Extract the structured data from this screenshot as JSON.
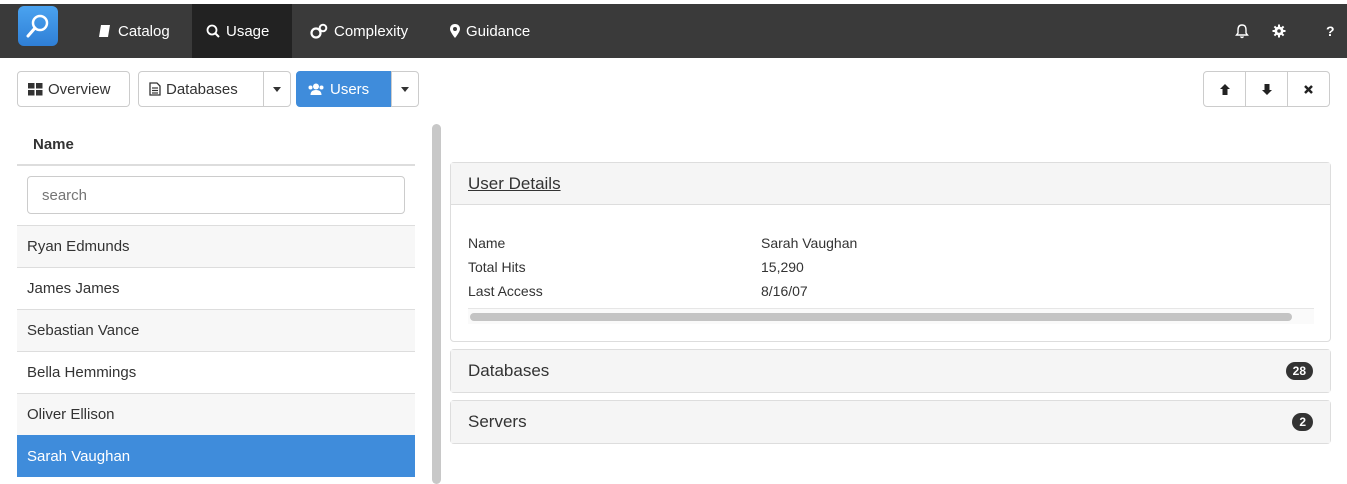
{
  "nav": {
    "items": [
      {
        "label": "Catalog",
        "icon": "book-icon"
      },
      {
        "label": "Usage",
        "icon": "search-icon"
      },
      {
        "label": "Complexity",
        "icon": "cogs-icon"
      },
      {
        "label": "Guidance",
        "icon": "map-marker-icon"
      }
    ],
    "active_item": "Usage",
    "help_label": "?"
  },
  "toolbar": {
    "overview_label": "Overview",
    "databases_label": "Databases",
    "users_label": "Users",
    "active": "Users"
  },
  "list": {
    "header": "Name",
    "search_placeholder": "search",
    "items": [
      "Ryan Edmunds",
      "James James",
      "Sebastian Vance",
      "Bella Hemmings",
      "Oliver Ellison",
      "Sarah Vaughan"
    ],
    "selected": "Sarah Vaughan"
  },
  "details": {
    "title": "User Details",
    "rows": [
      {
        "label": "Name",
        "value": "Sarah Vaughan"
      },
      {
        "label": "Total Hits",
        "value": "15,290"
      },
      {
        "label": "Last Access",
        "value": "8/16/07"
      }
    ]
  },
  "databases_panel": {
    "title": "Databases",
    "count": "28"
  },
  "servers_panel": {
    "title": "Servers",
    "count": "2"
  },
  "colors": {
    "accent": "#3f8cdb",
    "nav_bg": "#3a3a3a",
    "nav_active": "#222222"
  }
}
